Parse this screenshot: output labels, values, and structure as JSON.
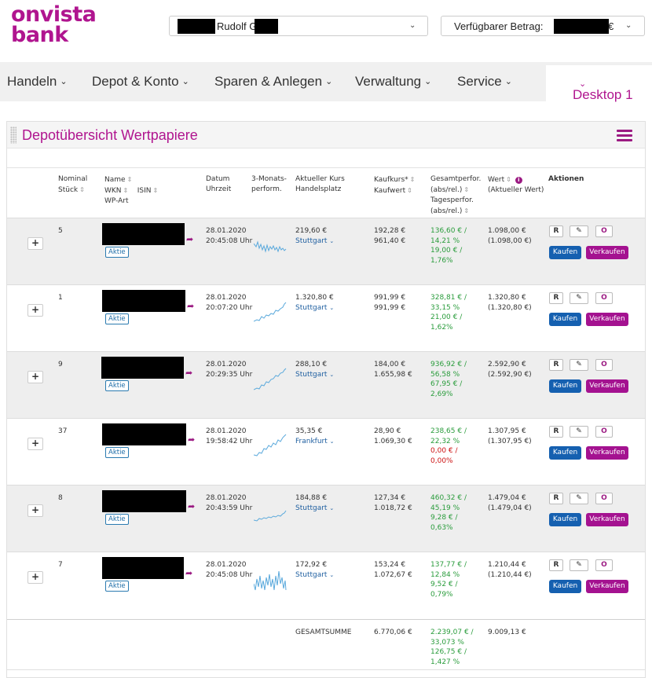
{
  "header": {
    "logo_line1": "onvista",
    "logo_line2": "bank",
    "account_name": "Rudolf G",
    "available_label": "Verfügbarer Betrag:",
    "available_currency": "€"
  },
  "nav": {
    "items": [
      "Handeln",
      "Depot & Konto",
      "Sparen & Anlegen",
      "Verwaltung",
      "Service"
    ],
    "desktop": "Desktop 1"
  },
  "panel": {
    "title": "Depotübersicht Wertpapiere"
  },
  "table": {
    "headers": {
      "nominal": "Nominal",
      "stueck": "Stück",
      "name": "Name",
      "wkn": "WKN",
      "isin": "ISIN",
      "wpart": "WP-Art",
      "datum": "Datum",
      "uhrzeit": "Uhrzeit",
      "perf3m_1": "3-Monats-",
      "perf3m_2": "perform.",
      "kurs": "Aktueller Kurs",
      "handelsplatz": "Handelsplatz",
      "kaufkurs": "Kaufkurs*",
      "kaufwert": "Kaufwert",
      "gesamt1": "Gesamtperfor.",
      "gesamt2": "(abs/rel.)",
      "tages1": "Tagesperfor.",
      "tages2": "(abs/rel.)",
      "wert": "Wert",
      "aktwert": "(Aktueller Wert)",
      "aktionen": "Aktionen"
    },
    "buttons": {
      "r": "R",
      "o": "O",
      "kaufen": "Kaufen",
      "verkaufen": "Verkaufen",
      "badge": "Aktie",
      "plus": "+"
    },
    "rows": [
      {
        "qty": "5",
        "date": "28.01.2020",
        "time": "20:45:08 Uhr",
        "price": "219,60 €",
        "place": "Stuttgart",
        "buy_price": "192,28 €",
        "buy_value": "961,40 €",
        "perf_abs": "136,60 € /",
        "perf_rel": "14,21 %",
        "day_abs": "19,00 € /",
        "day_rel": "1,76%",
        "day_color": "green",
        "value": "1.098,00 €",
        "value_cur": "(1.098,00 €)"
      },
      {
        "qty": "1",
        "date": "28.01.2020",
        "time": "20:07:20 Uhr",
        "price": "1.320,80 €",
        "place": "Stuttgart",
        "buy_price": "991,99 €",
        "buy_value": "991,99 €",
        "perf_abs": "328,81 € /",
        "perf_rel": "33,15 %",
        "day_abs": "21,00 € /",
        "day_rel": "1,62%",
        "day_color": "green",
        "value": "1.320,80 €",
        "value_cur": "(1.320,80 €)"
      },
      {
        "qty": "9",
        "date": "28.01.2020",
        "time": "20:29:35 Uhr",
        "price": "288,10 €",
        "place": "Stuttgart",
        "buy_price": "184,00 €",
        "buy_value": "1.655,98 €",
        "perf_abs": "936,92 € /",
        "perf_rel": "56,58 %",
        "day_abs": "67,95 € /",
        "day_rel": "2,69%",
        "day_color": "green",
        "value": "2.592,90 €",
        "value_cur": "(2.592,90 €)"
      },
      {
        "qty": "37",
        "date": "28.01.2020",
        "time": "19:58:42 Uhr",
        "price": "35,35 €",
        "place": "Frankfurt",
        "buy_price": "28,90 €",
        "buy_value": "1.069,30 €",
        "perf_abs": "238,65 € /",
        "perf_rel": "22,32 %",
        "day_abs": "0,00 € /",
        "day_rel": "0,00%",
        "day_color": "red",
        "value": "1.307,95 €",
        "value_cur": "(1.307,95 €)"
      },
      {
        "qty": "8",
        "date": "28.01.2020",
        "time": "20:43:59 Uhr",
        "price": "184,88 €",
        "place": "Stuttgart",
        "buy_price": "127,34 €",
        "buy_value": "1.018,72 €",
        "perf_abs": "460,32 € /",
        "perf_rel": "45,19 %",
        "day_abs": "9,28 € /",
        "day_rel": "0,63%",
        "day_color": "green",
        "value": "1.479,04 €",
        "value_cur": "(1.479,04 €)"
      },
      {
        "qty": "7",
        "date": "28.01.2020",
        "time": "20:45:08 Uhr",
        "price": "172,92 €",
        "place": "Stuttgart",
        "buy_price": "153,24 €",
        "buy_value": "1.072,67 €",
        "perf_abs": "137,77 € /",
        "perf_rel": "12,84 %",
        "day_abs": "9,52 € /",
        "day_rel": "0,79%",
        "day_color": "green",
        "value": "1.210,44 €",
        "value_cur": "(1.210,44 €)"
      }
    ],
    "total": {
      "label": "GESAMTSUMME",
      "buy_value": "6.770,06 €",
      "perf_abs": "2.239,07 € /",
      "perf_rel": "33,073 %",
      "day_abs": "126,75 € /",
      "day_rel": "1,427 %",
      "value": "9.009,13 €"
    }
  },
  "colors": {
    "brand": "#b0158f",
    "kaufen": "#1560b0",
    "verkaufen": "#a41290",
    "positive": "#2a9c3c",
    "negative": "#cc1111"
  }
}
